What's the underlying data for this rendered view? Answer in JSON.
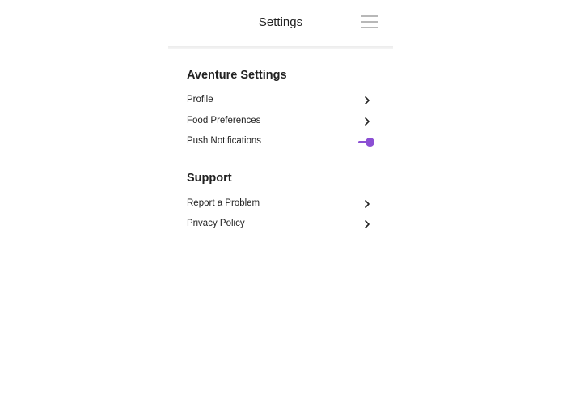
{
  "header": {
    "title": "Settings",
    "menu_icon": "hamburger-menu-icon"
  },
  "sections": [
    {
      "title": "Aventure Settings",
      "items": [
        {
          "label": "Profile",
          "control": "chevron-right-icon"
        },
        {
          "label": "Food Preferences",
          "control": "chevron-right-icon"
        },
        {
          "label": "Push Notifications",
          "control": "toggle",
          "toggle_on": true
        }
      ]
    },
    {
      "title": "Support",
      "items": [
        {
          "label": "Report a Problem",
          "control": "chevron-right-icon"
        },
        {
          "label": "Privacy Policy",
          "control": "chevron-right-icon"
        }
      ]
    }
  ],
  "colors": {
    "accent": "#8b4fd3",
    "text": "#222222",
    "menu_icon": "#b8b8b8",
    "divider": "#ececec"
  }
}
